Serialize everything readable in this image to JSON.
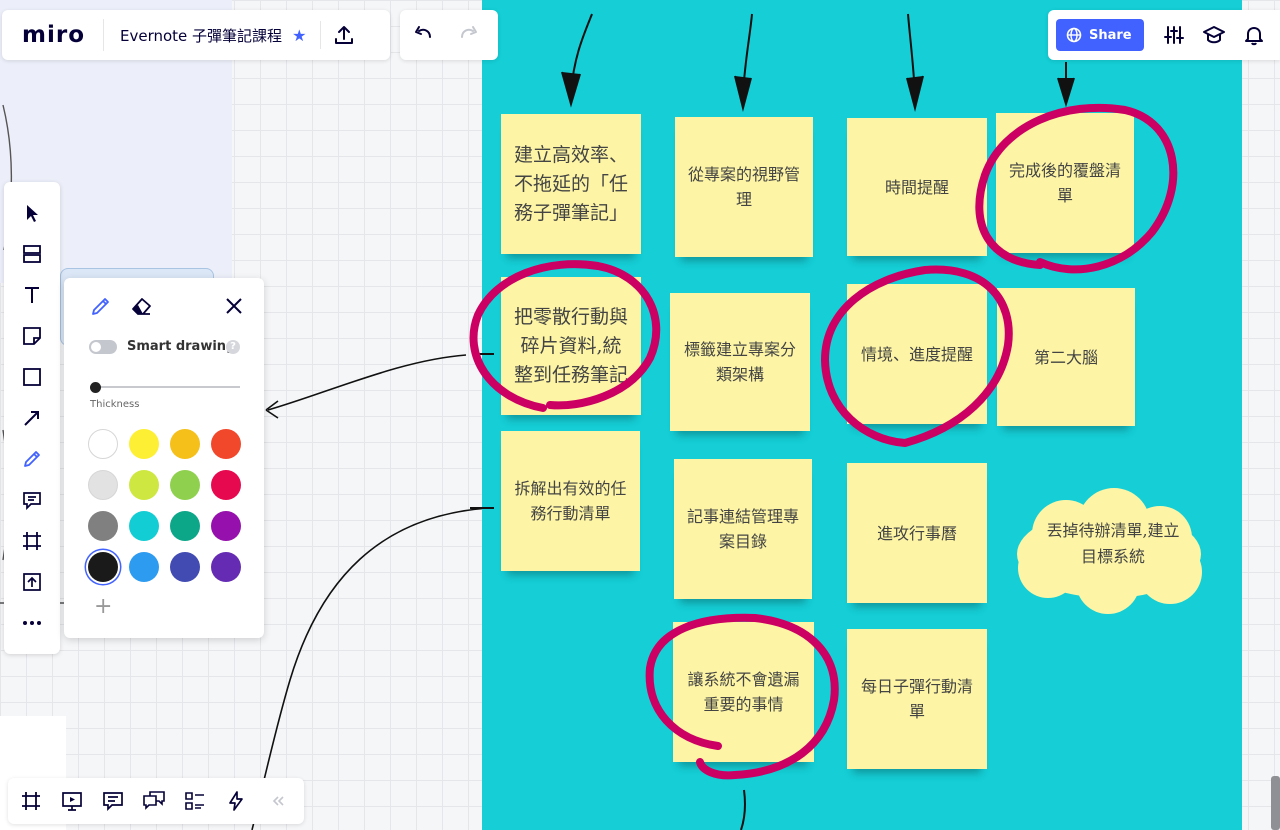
{
  "header": {
    "logo": "miro",
    "board_title": "Evernote 子彈筆記課程",
    "star_icon": "star-icon",
    "share_label": "Share"
  },
  "toolbar": {
    "tools": [
      "cursor-icon",
      "templates-icon",
      "text-icon",
      "sticky-note-icon",
      "shape-icon",
      "arrow-icon",
      "pen-icon",
      "comment-icon",
      "frame-icon",
      "upload-icon",
      "more-icon"
    ]
  },
  "pen_panel": {
    "smart_drawing_label": "Smart drawing",
    "help": "?",
    "thickness_label": "Thickness",
    "add_label": "+",
    "colors": [
      "#ffffff",
      "#fdef33",
      "#f5c01a",
      "#f1472a",
      "#e2e2e2",
      "#cee741",
      "#8fd14f",
      "#e6094f",
      "#808080",
      "#12cdd4",
      "#0ca789",
      "#9510ac",
      "#1a1a1a",
      "#2d9bf0",
      "#414bb2",
      "#652cb3"
    ],
    "selected_color": "#1a1a1a"
  },
  "stickies": [
    {
      "text": "建立高效率、不拖延的「任務子彈筆記」"
    },
    {
      "text": "從專案的視野管理"
    },
    {
      "text": "時間提醒"
    },
    {
      "text": "完成後的覆盤清單"
    },
    {
      "text": "把零散行動與碎片資料,統整到任務筆記"
    },
    {
      "text": "標籤建立專案分類架構"
    },
    {
      "text": "情境、進度提醒"
    },
    {
      "text": "第二大腦"
    },
    {
      "text": "拆解出有效的任務行動清單"
    },
    {
      "text": "記事連結管理專案目錄"
    },
    {
      "text": "進攻行事曆"
    },
    {
      "text": "讓系統不會遺漏重要的事情"
    },
    {
      "text": "每日子彈行動清單"
    }
  ],
  "cloud": {
    "text": "丟掉待辦清單,建立目標系統"
  },
  "colors": {
    "board": "#15ced6",
    "sticky": "#fdf5a5",
    "accent": "#4262ff",
    "marker": "#cc0063"
  },
  "bottom_toolbar": {
    "icons": [
      "frames-icon",
      "presentation-icon",
      "comments-icon",
      "chat-icon",
      "card-icon",
      "lightning-icon",
      "collapse-icon"
    ]
  }
}
